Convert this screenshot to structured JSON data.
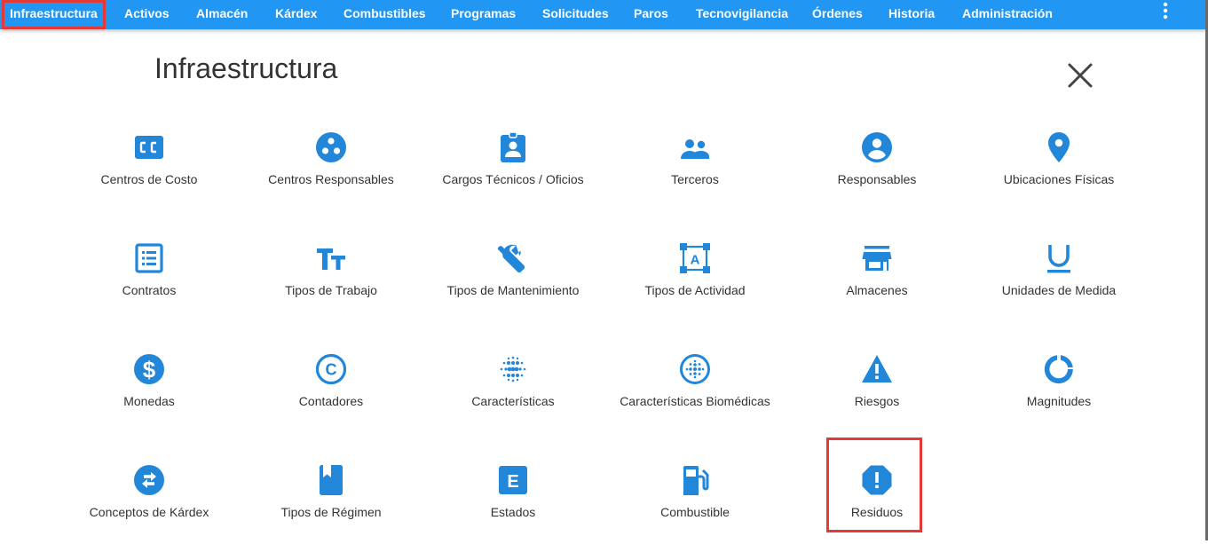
{
  "nav": {
    "items": [
      {
        "label": "Infraestructura"
      },
      {
        "label": "Activos"
      },
      {
        "label": "Almacén"
      },
      {
        "label": "Kárdex"
      },
      {
        "label": "Combustibles"
      },
      {
        "label": "Programas"
      },
      {
        "label": "Solicitudes"
      },
      {
        "label": "Paros"
      },
      {
        "label": "Tecnovigilancia"
      },
      {
        "label": "Órdenes"
      },
      {
        "label": "Historia"
      },
      {
        "label": "Administración"
      }
    ],
    "menu_icon": "more-vert-icon"
  },
  "page": {
    "title": "Infraestructura",
    "close_icon": "close-icon"
  },
  "colors": {
    "navbar": "#2196f3",
    "icon": "#2286d9",
    "highlight": "#e53935"
  },
  "tiles": [
    {
      "label": "Centros de Costo",
      "icon": "cc-badge-icon"
    },
    {
      "label": "Centros Responsables",
      "icon": "bubble-chart-icon"
    },
    {
      "label": "Cargos Técnicos / Oficios",
      "icon": "id-badge-icon"
    },
    {
      "label": "Terceros",
      "icon": "people-icon"
    },
    {
      "label": "Responsables",
      "icon": "account-circle-icon"
    },
    {
      "label": "Ubicaciones Físicas",
      "icon": "location-pin-icon"
    },
    {
      "label": "Contratos",
      "icon": "list-alt-icon"
    },
    {
      "label": "Tipos de Trabajo",
      "icon": "text-fields-icon"
    },
    {
      "label": "Tipos de Mantenimiento",
      "icon": "wrench-icon"
    },
    {
      "label": "Tipos de Actividad",
      "icon": "format-shapes-icon"
    },
    {
      "label": "Almacenes",
      "icon": "store-icon"
    },
    {
      "label": "Unidades de Medida",
      "icon": "underline-u-icon"
    },
    {
      "label": "Monedas",
      "icon": "dollar-circle-icon"
    },
    {
      "label": "Contadores",
      "icon": "copyright-c-icon"
    },
    {
      "label": "Características",
      "icon": "blur-dots-icon"
    },
    {
      "label": "Características Biomédicas",
      "icon": "blur-circle-icon"
    },
    {
      "label": "Riesgos",
      "icon": "warning-triangle-icon"
    },
    {
      "label": "Magnitudes",
      "icon": "donut-icon"
    },
    {
      "label": "Conceptos de Kárdex",
      "icon": "swap-circle-icon"
    },
    {
      "label": "Tipos de Régimen",
      "icon": "book-icon"
    },
    {
      "label": "Estados",
      "icon": "letter-e-box-icon"
    },
    {
      "label": "Combustible",
      "icon": "gas-station-icon"
    },
    {
      "label": "Residuos",
      "icon": "report-octagon-icon"
    }
  ]
}
